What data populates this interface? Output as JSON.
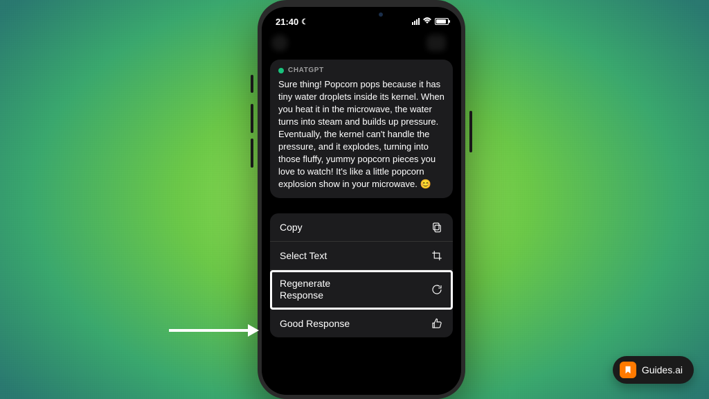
{
  "status": {
    "time": "21:40"
  },
  "message": {
    "sender": "CHATGPT",
    "body": "Sure thing! Popcorn pops because it has tiny water droplets inside its kernel. When you heat it in the microwave, the water turns into steam and builds up pressure. Eventually, the kernel can't handle the pressure, and it explodes, turning into those fluffy, yummy popcorn pieces you love to watch! It's like a little popcorn explosion show in your microwave. 😊"
  },
  "menu": {
    "copy": "Copy",
    "select_text": "Select Text",
    "regenerate": "Regenerate\nResponse",
    "good_response": "Good Response"
  },
  "branding": {
    "label": "Guides.ai"
  }
}
